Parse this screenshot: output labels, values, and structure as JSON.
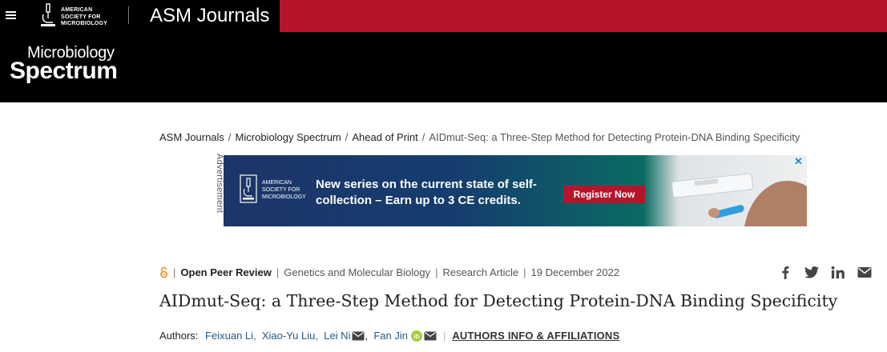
{
  "header": {
    "society_name_line1": "AMERICAN",
    "society_name_line2": "SOCIETY FOR",
    "society_name_line3": "MICROBIOLOGY",
    "site_title": "ASM Journals",
    "brand_red": "#b5152b"
  },
  "journal": {
    "name_line1": "Microbiology",
    "name_line2": "Spectrum"
  },
  "breadcrumb": {
    "items": [
      "ASM Journals",
      "Microbiology Spectrum",
      "Ahead of Print"
    ],
    "current": "AIDmut-Seq: a Three-Step Method for Detecting Protein-DNA Binding Specificity",
    "separator": "/"
  },
  "ad": {
    "label": "Advertisement",
    "logo_line1": "AMERICAN",
    "logo_line2": "SOCIETY FOR",
    "logo_line3": "MICROBIOLOGY",
    "headline": "New series on the current state of self-collection – Earn up to 3 CE credits.",
    "cta": "Register Now"
  },
  "article": {
    "meta": {
      "peer_review": "Open Peer Review",
      "subject": "Genetics and Molecular Biology",
      "type": "Research Article",
      "date": "19 December 2022",
      "separator": "|"
    },
    "title": "AIDmut-Seq: a Three-Step Method for Detecting Protein-DNA Binding Specificity",
    "authors_label": "Authors:",
    "authors": [
      "Feixuan Li,",
      "Xiao-Yu Liu,",
      "Lei Ni",
      "Fan Jin"
    ],
    "authors_info": "AUTHORS INFO & AFFILIATIONS"
  },
  "share_icons": [
    "facebook-icon",
    "twitter-icon",
    "linkedin-icon",
    "email-icon"
  ]
}
